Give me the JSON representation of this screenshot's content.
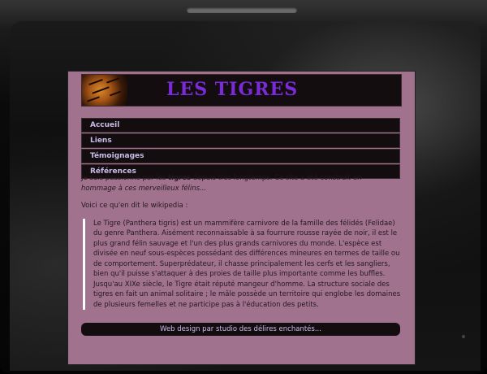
{
  "site": {
    "banner_title": "LES TIGRES",
    "nav": [
      {
        "label": "Accueil"
      },
      {
        "label": "Liens"
      },
      {
        "label": "Témoignages"
      },
      {
        "label": "Références"
      }
    ],
    "intro_line1_a": "Je suis passionné par les ",
    "intro_line1_b": "tigres",
    "intro_line1_c": " depuis très longtemps. Ce site a été construit en",
    "intro_line2": "hommage à ces merveilleux félins...",
    "wiki_intro": "Voici ce qu'en dit le wikipedia :",
    "quote": "Le Tigre (Panthera tigris) est un mammifère carnivore de la famille des félidés (Felidae) du genre Panthera. Aisément reconnaissable à sa fourrure rousse rayée de noir, il est le plus grand félin sauvage et l'un des plus grands carnivores du monde. L'espèce est divisée en neuf sous-espèces possédant des différences mineures en termes de taille ou de comportement. Superprédateur, il chasse principalement les cerfs et les sangliers, bien qu'il puisse s'attaquer à des proies de taille plus importante comme les buffles. Jusqu'au XIXe siècle, le Tigre était réputé mangeur d'homme. La structure sociale des tigres en fait un animal solitaire ; le mâle possède un territoire qui englobe les domaines de plusieurs femelles et ne participe pas à l'éducation des petits.",
    "footer": "Web design par studio des délires enchantés..."
  }
}
